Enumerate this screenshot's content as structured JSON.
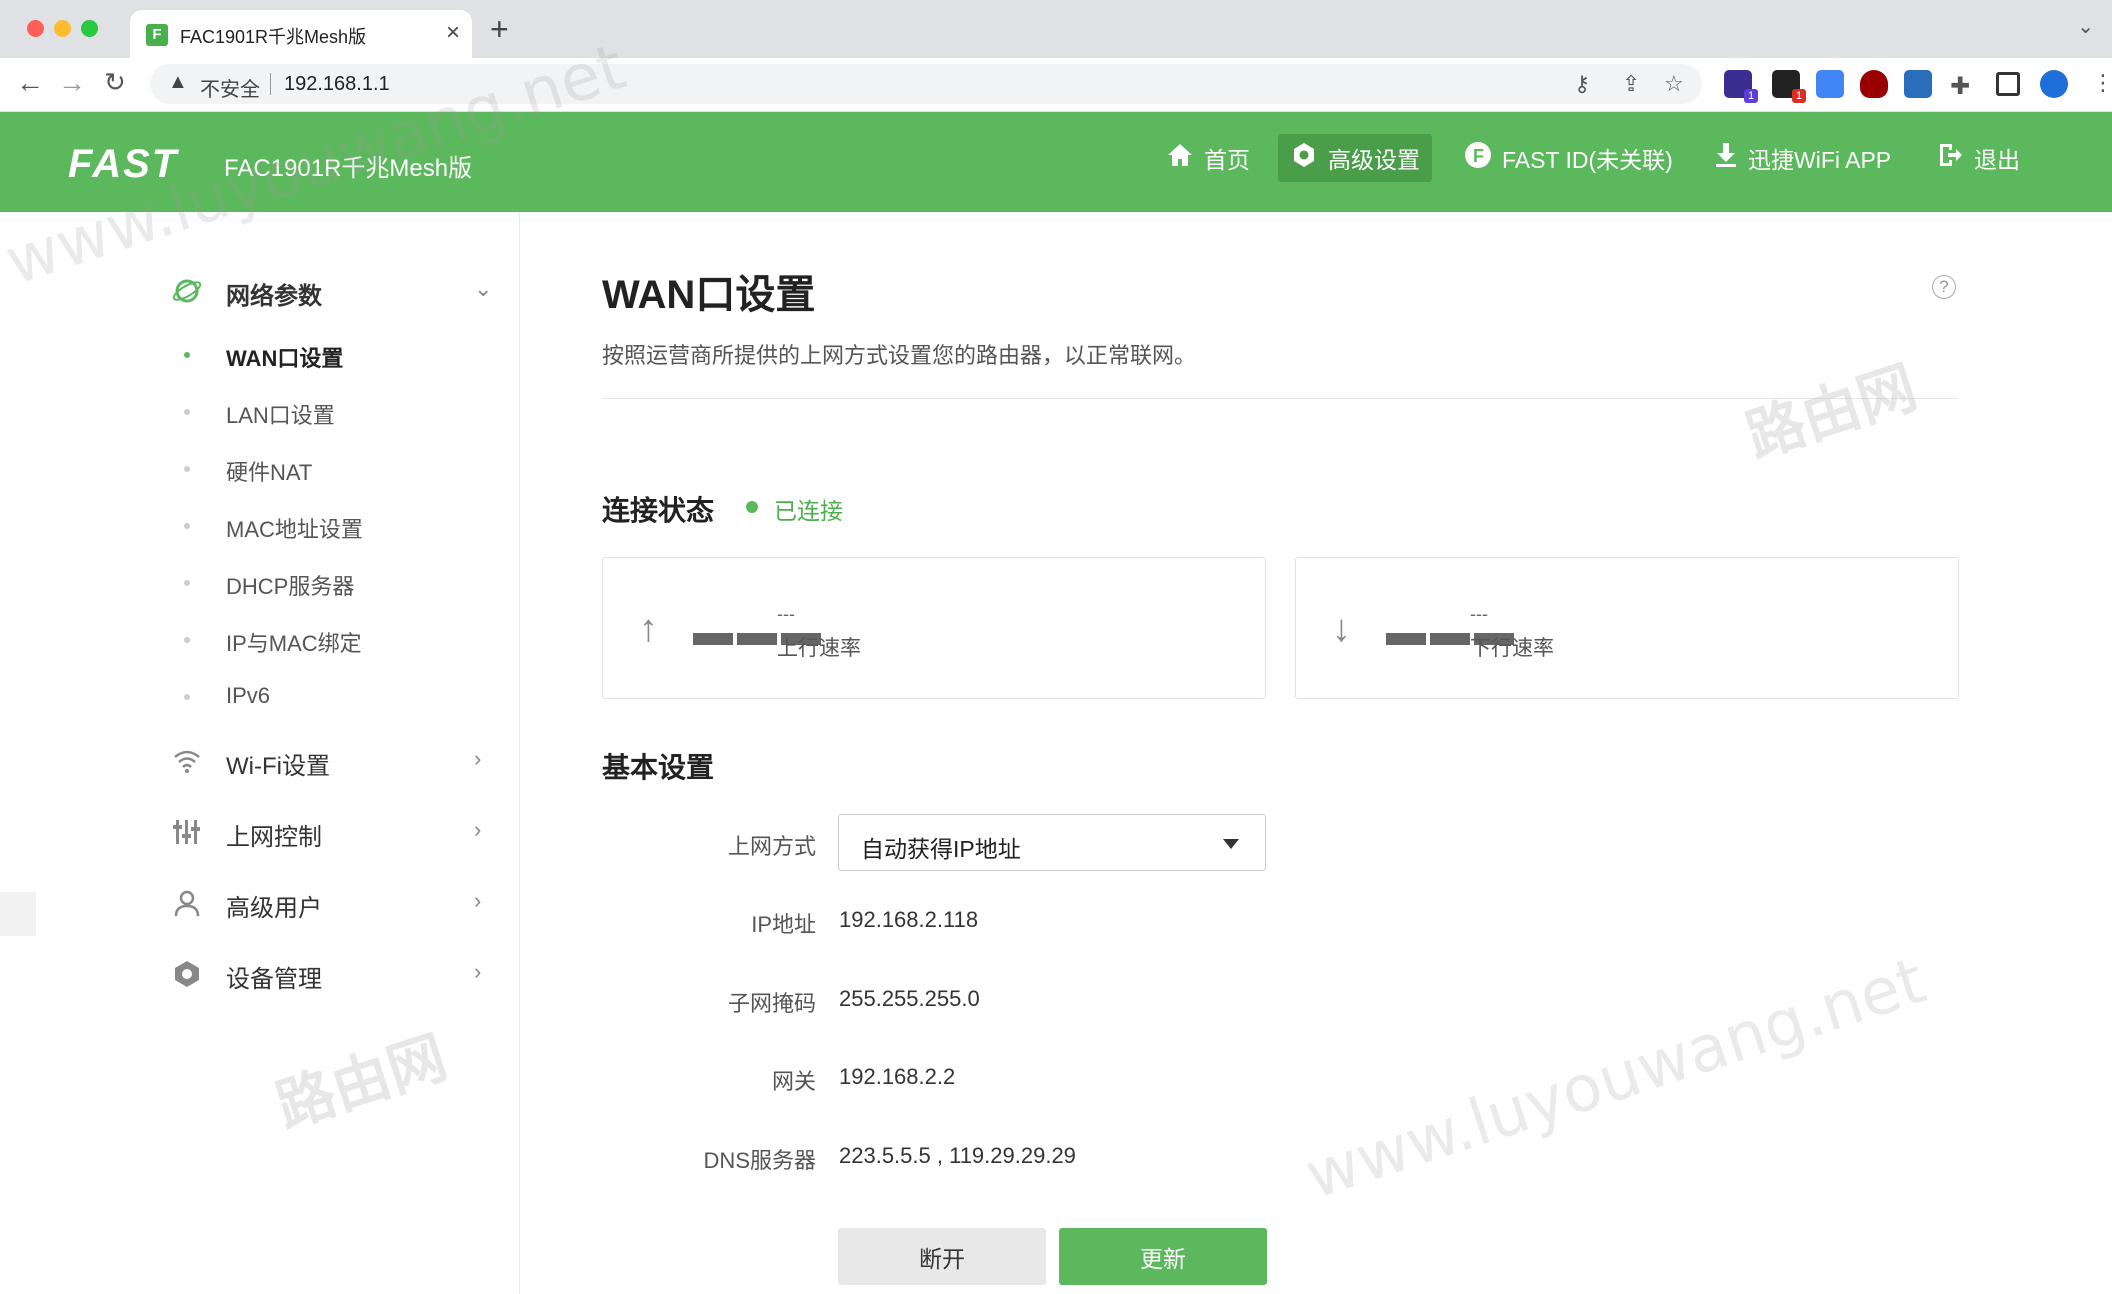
{
  "browser": {
    "tab_title": "FAC1901R千兆Mesh版",
    "tab_favicon": "F",
    "insecure_label": "不安全",
    "url": "192.168.1.1",
    "ext_badges": [
      "1",
      "1"
    ]
  },
  "app": {
    "logo": "FAST",
    "model": "FAC1901R千兆Mesh版",
    "nav": [
      {
        "label": "首页",
        "icon": "home-icon"
      },
      {
        "label": "高级设置",
        "icon": "settings-icon"
      },
      {
        "label": "FAST ID(未关联)",
        "icon": "fast-id-icon"
      },
      {
        "label": "迅捷WiFi APP",
        "icon": "download-icon"
      },
      {
        "label": "退出",
        "icon": "logout-icon"
      }
    ],
    "brand_color": "#5cb85c"
  },
  "sidebar": {
    "groups": [
      {
        "label": "网络参数",
        "icon": "network-icon",
        "expanded": true
      },
      {
        "label": "Wi-Fi设置",
        "icon": "wifi-icon"
      },
      {
        "label": "上网控制",
        "icon": "control-icon"
      },
      {
        "label": "高级用户",
        "icon": "user-icon"
      },
      {
        "label": "设备管理",
        "icon": "device-icon"
      }
    ],
    "sub_items": [
      "WAN口设置",
      "LAN口设置",
      "硬件NAT",
      "MAC地址设置",
      "DHCP服务器",
      "IP与MAC绑定",
      "IPv6"
    ]
  },
  "main": {
    "title": "WAN口设置",
    "description": "按照运营商所提供的上网方式设置您的路由器，以正常联网。",
    "status_title": "连接状态",
    "status_text": "已连接",
    "upload": {
      "value": "---",
      "label": "上行速率"
    },
    "download": {
      "value": "---",
      "label": "下行速率"
    },
    "basic_title": "基本设置",
    "fields": {
      "mode_label": "上网方式",
      "mode_value": "自动获得IP地址",
      "ip_label": "IP地址",
      "ip_value": "192.168.2.118",
      "mask_label": "子网掩码",
      "mask_value": "255.255.255.0",
      "gateway_label": "网关",
      "gateway_value": "192.168.2.2",
      "dns_label": "DNS服务器",
      "dns_value": "223.5.5.5 , 119.29.29.29"
    },
    "disconnect_label": "断开",
    "refresh_label": "更新"
  },
  "watermark": {
    "url_text": "www.luyouwang.net",
    "cn_text": "路由网"
  }
}
